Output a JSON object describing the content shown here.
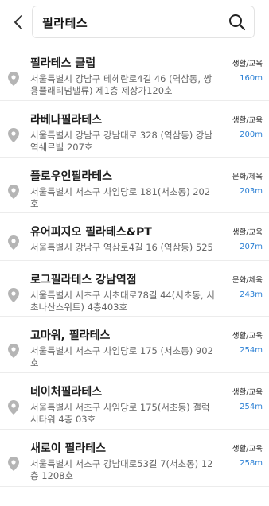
{
  "search": {
    "query": "필라테스"
  },
  "results": [
    {
      "name": "필라테스 클럽",
      "address": "서울특별시 강남구 테헤란로4길 46 (역삼동, 쌍용플래티넘밸류) 제1층 제상가120호",
      "category": "생활/교육",
      "distance": "160m"
    },
    {
      "name": "라베나필라테스",
      "address": "서울특별시 강남구 강남대로 328 (역삼동) 강남역쉐르빌 207호",
      "category": "생활/교육",
      "distance": "200m"
    },
    {
      "name": "플로우인필라테스",
      "address": "서울특별시 서초구 사임당로 181(서초동) 202호",
      "category": "문화/체육",
      "distance": "203m"
    },
    {
      "name": "유어피지오 필라테스&PT",
      "address": "서울특별시 강남구 역삼로4길 16 (역삼동) 525",
      "category": "생활/교육",
      "distance": "207m"
    },
    {
      "name": "로그필라테스 강남역점",
      "address": "서울특별시 서초구 서초대로78길 44(서초동, 서초나산스위트) 4층403호",
      "category": "문화/체육",
      "distance": "243m"
    },
    {
      "name": "고마워, 필라테스",
      "address": "서울특별시 서초구 사임당로 175 (서초동) 902호",
      "category": "생활/교육",
      "distance": "254m"
    },
    {
      "name": "네이처필라테스",
      "address": "서울특별시 서초구 사임당로 175(서초동) 갤럭시타워 4층 03호",
      "category": "생활/교육",
      "distance": "254m"
    },
    {
      "name": "새로이 필라테스",
      "address": "서울특별시 서초구 강남대로53길 7(서초동) 12층 1208호",
      "category": "생활/교육",
      "distance": "258m"
    }
  ],
  "colors": {
    "distance": "#2a7fd4",
    "pin": "#b5b5b5"
  },
  "icons": {
    "back": "chevron-left-icon",
    "search": "search-icon",
    "pin": "map-pin-icon"
  }
}
